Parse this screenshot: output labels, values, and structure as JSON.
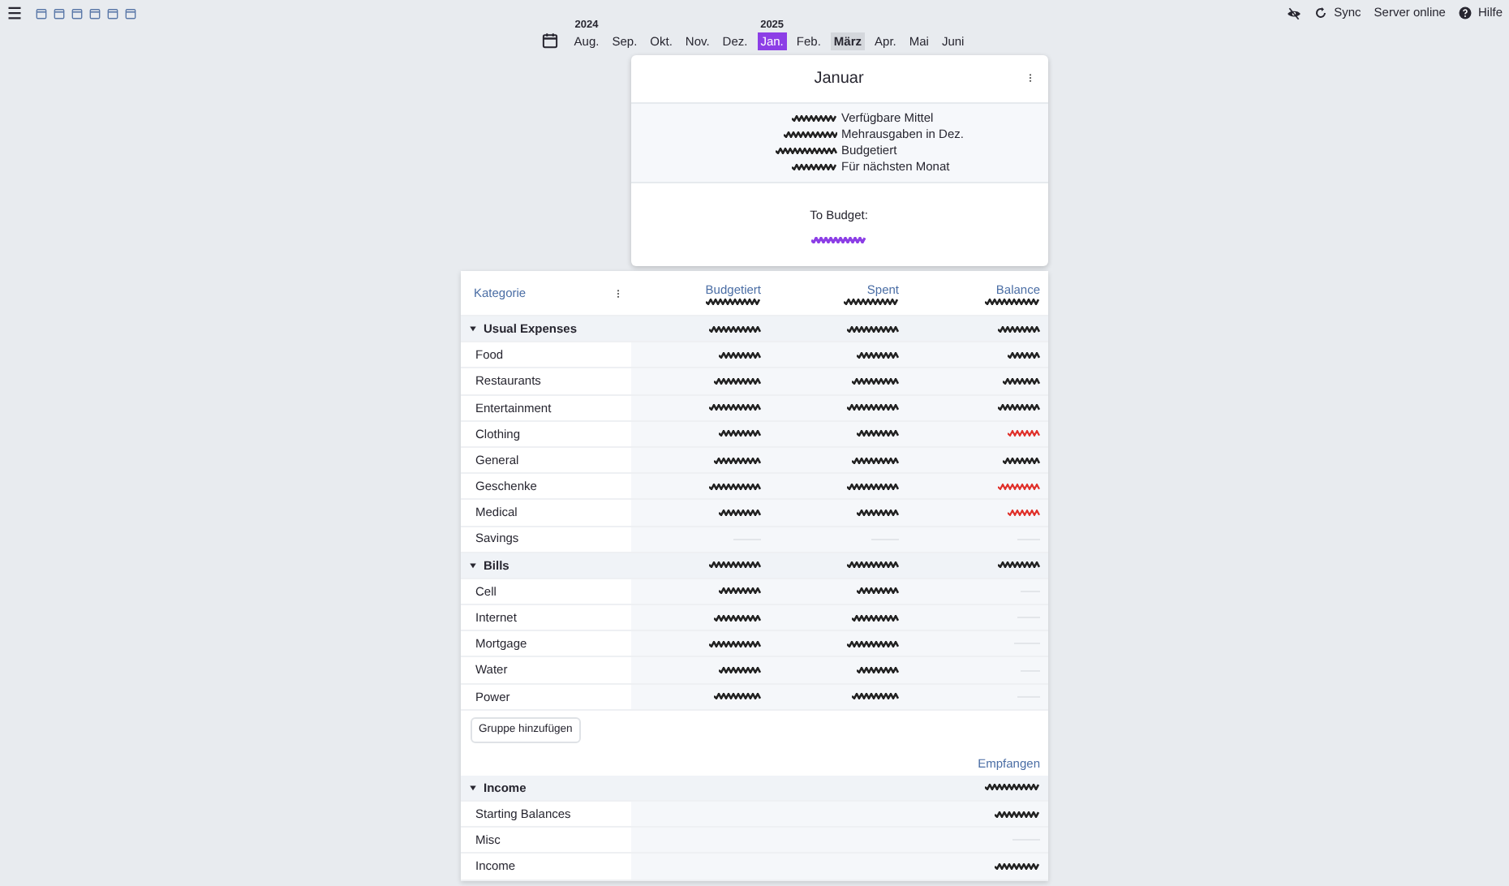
{
  "topbar": {
    "sync_label": "Sync",
    "server_status": "Server online",
    "help_label": "Hilfe"
  },
  "months": [
    {
      "label": "Aug.",
      "year": "2024",
      "selected": false,
      "current": false
    },
    {
      "label": "Sep.",
      "selected": false,
      "current": false
    },
    {
      "label": "Okt.",
      "selected": false,
      "current": false
    },
    {
      "label": "Nov.",
      "selected": false,
      "current": false
    },
    {
      "label": "Dez.",
      "selected": false,
      "current": false
    },
    {
      "label": "Jan.",
      "year": "2025",
      "selected": true,
      "current": false
    },
    {
      "label": "Feb.",
      "selected": false,
      "current": false
    },
    {
      "label": "März",
      "selected": false,
      "current": true
    },
    {
      "label": "Apr.",
      "selected": false,
      "current": false
    },
    {
      "label": "Mai",
      "selected": false,
      "current": false
    },
    {
      "label": "Juni",
      "selected": false,
      "current": false
    }
  ],
  "summary": {
    "title": "Januar",
    "lines": [
      {
        "label": "Verfügbare Mittel",
        "amount": {
          "negative": false,
          "zero": false
        }
      },
      {
        "label": "Mehrausgaben in Dez.",
        "amount": {
          "negative": false,
          "zero": false
        }
      },
      {
        "label": "Budgetiert",
        "amount": {
          "negative": false,
          "zero": false
        }
      },
      {
        "label": "Für nächsten Monat",
        "amount": {
          "negative": false,
          "zero": false
        }
      }
    ],
    "to_budget_label": "To Budget:",
    "to_budget_amount": {
      "accent": true,
      "zero": false
    }
  },
  "table": {
    "category_header": "Kategorie",
    "columns": [
      {
        "label": "Budgetiert",
        "amount": {
          "negative": false,
          "zero": false
        }
      },
      {
        "label": "Spent",
        "amount": {
          "negative": false,
          "zero": false
        }
      },
      {
        "label": "Balance",
        "amount": {
          "negative": false,
          "zero": false
        }
      }
    ],
    "expense_groups": [
      {
        "name": "Usual Expenses",
        "expanded": true,
        "totals": [
          {
            "negative": false,
            "zero": false
          },
          {
            "negative": false,
            "zero": false
          },
          {
            "negative": false,
            "zero": false
          }
        ],
        "categories": [
          {
            "name": "Food",
            "amounts": [
              {
                "negative": false,
                "zero": false
              },
              {
                "negative": false,
                "zero": false
              },
              {
                "negative": false,
                "zero": false
              }
            ]
          },
          {
            "name": "Restaurants",
            "amounts": [
              {
                "negative": false,
                "zero": false
              },
              {
                "negative": false,
                "zero": false
              },
              {
                "negative": false,
                "zero": false
              }
            ]
          },
          {
            "name": "Entertainment",
            "amounts": [
              {
                "negative": false,
                "zero": false
              },
              {
                "negative": false,
                "zero": false
              },
              {
                "negative": false,
                "zero": false
              }
            ]
          },
          {
            "name": "Clothing",
            "amounts": [
              {
                "negative": false,
                "zero": false
              },
              {
                "negative": false,
                "zero": false
              },
              {
                "negative": true,
                "zero": false
              }
            ]
          },
          {
            "name": "General",
            "amounts": [
              {
                "negative": false,
                "zero": false
              },
              {
                "negative": false,
                "zero": false
              },
              {
                "negative": false,
                "zero": false
              }
            ]
          },
          {
            "name": "Geschenke",
            "amounts": [
              {
                "negative": false,
                "zero": false
              },
              {
                "negative": false,
                "zero": false
              },
              {
                "negative": true,
                "zero": false
              }
            ]
          },
          {
            "name": "Medical",
            "amounts": [
              {
                "negative": false,
                "zero": false
              },
              {
                "negative": false,
                "zero": false
              },
              {
                "negative": true,
                "zero": false
              }
            ]
          },
          {
            "name": "Savings",
            "amounts": [
              {
                "negative": false,
                "zero": true
              },
              {
                "negative": false,
                "zero": true
              },
              {
                "negative": false,
                "zero": true
              }
            ]
          }
        ]
      },
      {
        "name": "Bills",
        "expanded": true,
        "totals": [
          {
            "negative": false,
            "zero": false
          },
          {
            "negative": false,
            "zero": false
          },
          {
            "negative": false,
            "zero": false
          }
        ],
        "categories": [
          {
            "name": "Cell",
            "amounts": [
              {
                "negative": false,
                "zero": false
              },
              {
                "negative": false,
                "zero": false
              },
              {
                "negative": false,
                "zero": true
              }
            ]
          },
          {
            "name": "Internet",
            "amounts": [
              {
                "negative": false,
                "zero": false
              },
              {
                "negative": false,
                "zero": false
              },
              {
                "negative": false,
                "zero": true
              }
            ]
          },
          {
            "name": "Mortgage",
            "amounts": [
              {
                "negative": false,
                "zero": false
              },
              {
                "negative": false,
                "zero": false
              },
              {
                "negative": false,
                "zero": true
              }
            ]
          },
          {
            "name": "Water",
            "amounts": [
              {
                "negative": false,
                "zero": false
              },
              {
                "negative": false,
                "zero": false
              },
              {
                "negative": false,
                "zero": true
              }
            ]
          },
          {
            "name": "Power",
            "amounts": [
              {
                "negative": false,
                "zero": false
              },
              {
                "negative": false,
                "zero": false
              },
              {
                "negative": false,
                "zero": true
              }
            ]
          }
        ]
      }
    ],
    "add_group_button": "Gruppe hinzufügen",
    "income_header": "Empfangen",
    "income_group": {
      "name": "Income",
      "expanded": true,
      "total": {
        "negative": false,
        "zero": false
      },
      "categories": [
        {
          "name": "Starting Balances",
          "amount": {
            "negative": false,
            "zero": false
          }
        },
        {
          "name": "Misc",
          "amount": {
            "negative": false,
            "zero": true
          }
        },
        {
          "name": "Income",
          "amount": {
            "negative": false,
            "zero": false
          }
        }
      ]
    }
  }
}
